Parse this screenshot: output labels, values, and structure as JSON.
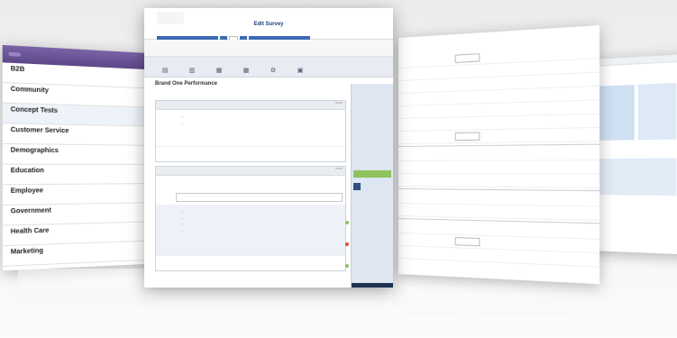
{
  "left_panel": {
    "header_button": "",
    "header_link": "",
    "categories": [
      {
        "label": "B2B",
        "sub": ""
      },
      {
        "label": "Community",
        "sub": ""
      },
      {
        "label": "Concept Tests",
        "sub": ""
      },
      {
        "label": "Customer Service",
        "sub": ""
      },
      {
        "label": "Demographics",
        "sub": ""
      },
      {
        "label": "Education",
        "sub": ""
      },
      {
        "label": "Employee",
        "sub": ""
      },
      {
        "label": "Government",
        "sub": ""
      },
      {
        "label": "Health Care",
        "sub": ""
      },
      {
        "label": "Marketing",
        "sub": ""
      }
    ]
  },
  "main_panel": {
    "window_title": "Edit Survey",
    "survey_title": "Brand One Performance",
    "tabs": [
      "",
      "",
      "",
      "",
      ""
    ],
    "toolbar": [
      {
        "icon": "chart-icon",
        "label": ""
      },
      {
        "icon": "chart-icon",
        "label": ""
      },
      {
        "icon": "grid-icon",
        "label": ""
      },
      {
        "icon": "grid-icon",
        "label": ""
      },
      {
        "icon": "gear-icon",
        "label": ""
      },
      {
        "icon": "chart-icon",
        "label": ""
      }
    ],
    "pages": [
      {
        "header": "",
        "action": ""
      },
      {
        "header": "",
        "action": ""
      }
    ],
    "sidebar_button": ""
  },
  "colors": {
    "accent": "#3d6bb3",
    "header_purple": "#5c4787",
    "green": "#8fc25a"
  }
}
